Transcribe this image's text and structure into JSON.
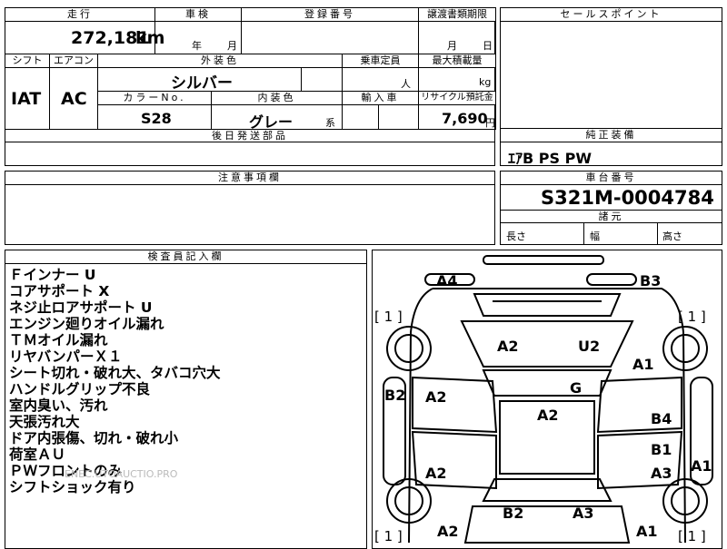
{
  "top": {
    "mileage_label": "走行",
    "mileage_value": "272,181",
    "mileage_unit": "km",
    "inspection_label": "車検",
    "year_unit": "年",
    "month_unit": "月",
    "reg_label": "登録番号",
    "transfer_label": "譲渡書類期限",
    "transfer_month": "月",
    "transfer_day": "日",
    "sales_label": "セールスポイント"
  },
  "row2": {
    "shift_label": "シフト",
    "shift_value": "IAT",
    "ac_label": "エアコン",
    "ac_value": "AC",
    "exterior_label": "外装色",
    "exterior_value": "シルバー",
    "capacity_label": "乗車定員",
    "capacity_unit": "人",
    "load_label": "最大積載量",
    "load_unit": "kg",
    "color_no_label": "カラーNo.",
    "color_no_value": "S28",
    "interior_label": "内装色",
    "interior_value": "グレー",
    "interior_suffix": "系",
    "import_label": "輸入車",
    "recycle_label": "リサイクル預託金",
    "recycle_value": "7,690",
    "recycle_unit": "円",
    "later_parts_label": "後日発送部品"
  },
  "equipment": {
    "label": "純正装備",
    "value": "ｴｱB PS PW"
  },
  "notes": {
    "label": "注意事項欄"
  },
  "chassis": {
    "label": "車台番号",
    "value": "S321M-0004784",
    "dims_label": "諸元",
    "length_label": "長さ",
    "width_label": "幅",
    "height_label": "高さ"
  },
  "inspector": {
    "label": "検査員記入欄",
    "lines": [
      "Ｆインナー U",
      "コアサポート X",
      "ネジ止ロアサポート U",
      "エンジン廻りオイル漏れ",
      "ＴＭオイル漏れ",
      "リヤバンパーＸ１",
      "シート切れ・破れ大、タバコ穴大",
      "ハンドルグリップ不良",
      "室内臭い、汚れ",
      "天張汚れ大",
      "ドア内張傷、切れ・破れ小",
      "荷室ＡＵ",
      "ＰＷフロントのみ",
      "シフトショック有り"
    ],
    "watermark": "ENEC.UTOAUCTIO.PRO"
  },
  "diagram": {
    "marks": {
      "a4": "A4",
      "b3": "B3",
      "hood_a2": "A2",
      "hood_u2": "U2",
      "fr_a1": "A1",
      "glass_g": "G",
      "b2_left": "B2",
      "door_fl_a2": "A2",
      "roof_a2": "A2",
      "door_fr_b4": "B4",
      "door_rr_b1": "B1",
      "door_rl_a2": "A2",
      "door_rr_a3": "A3",
      "side_r_a1": "A1",
      "rear_b2": "B2",
      "rear_a3": "A3",
      "rear_l_a2": "A2",
      "rear_r_a1": "A1"
    },
    "bracket_fl": "[ 1 ]",
    "bracket_fr": "[ 1 ]",
    "bracket_rl": "[ 1 ]",
    "bracket_rr": "[ 1 ]"
  }
}
